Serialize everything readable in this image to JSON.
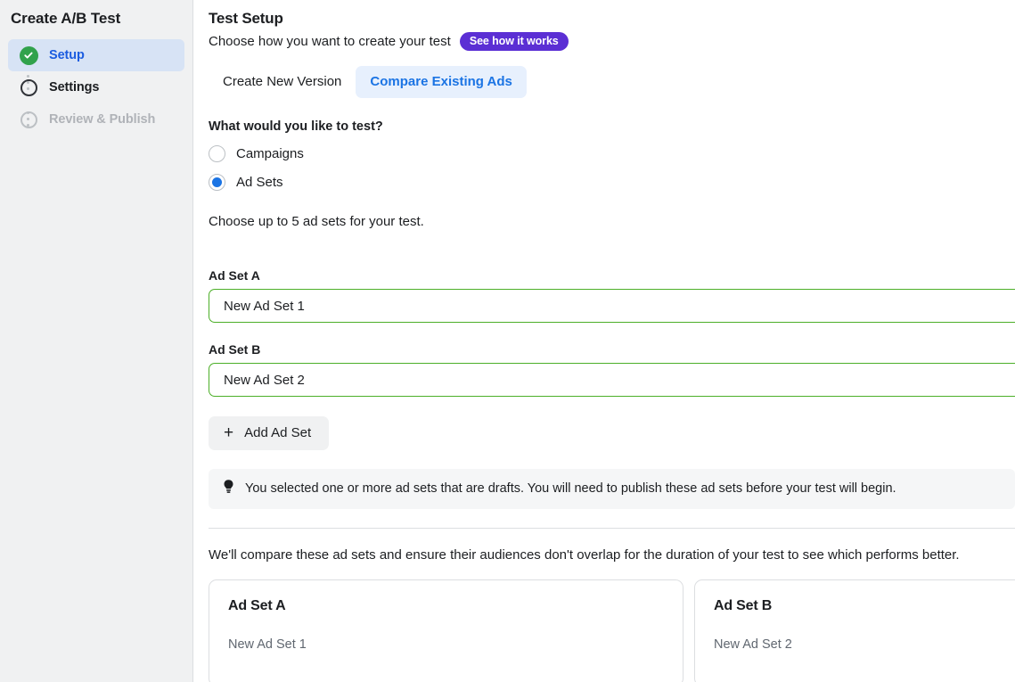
{
  "sidebar": {
    "title": "Create A/B Test",
    "items": [
      {
        "label": "Setup",
        "state": "done-active",
        "icon": "check-circle-icon"
      },
      {
        "label": "Settings",
        "state": "pending",
        "icon": "empty-circle-icon"
      },
      {
        "label": "Review & Publish",
        "state": "disabled",
        "icon": "empty-circle-icon"
      }
    ]
  },
  "main": {
    "title": "Test Setup",
    "subtitle": "Choose how you want to create your test",
    "badge_label": "See how it works",
    "tabs": [
      {
        "label": "Create New Version",
        "active": false
      },
      {
        "label": "Compare Existing Ads",
        "active": true
      }
    ],
    "question": "What would you like to test?",
    "options": [
      {
        "label": "Campaigns",
        "selected": false
      },
      {
        "label": "Ad Sets",
        "selected": true
      }
    ],
    "helper_text": "Choose up to 5 ad sets for your test.",
    "fields": [
      {
        "label": "Ad Set A",
        "value": "New Ad Set 1"
      },
      {
        "label": "Ad Set B",
        "value": "New Ad Set 2"
      }
    ],
    "add_button": {
      "label": "Add Ad Set",
      "icon": "plus-icon"
    },
    "notice": {
      "icon": "lightbulb-icon",
      "text": "You selected one or more ad sets that are drafts. You will need to publish these ad sets before your test will begin."
    },
    "compare_text": "We'll compare these ad sets and ensure their audiences don't overlap for the duration of your test to see which performs better.",
    "cards": [
      {
        "title": "Ad Set A",
        "subtitle": "New Ad Set 1"
      },
      {
        "title": "Ad Set B",
        "subtitle": "New Ad Set 2"
      }
    ]
  },
  "colors": {
    "accent_blue": "#1b74e4",
    "badge_purple": "#5b2fd4",
    "success_green": "#31a24c",
    "input_border_green": "#4caf28",
    "sidebar_bg": "#f0f1f2",
    "active_step_bg": "#d7e3f5",
    "active_tab_bg": "#e7f0fd"
  }
}
